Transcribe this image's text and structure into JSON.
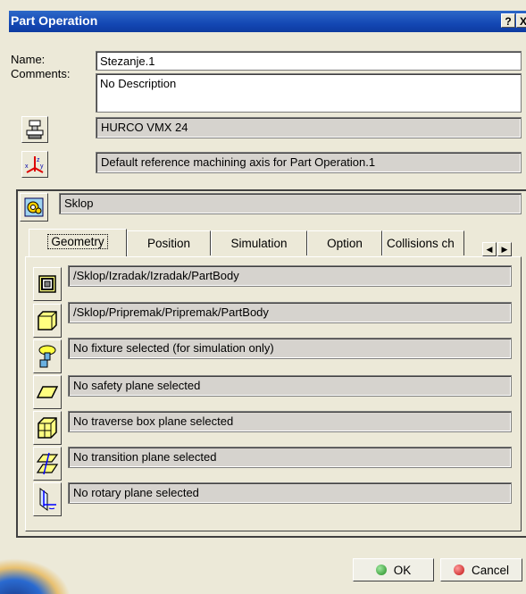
{
  "window": {
    "title": "Part Operation",
    "help_label": "?",
    "close_label": "X"
  },
  "name": {
    "label": "Name:",
    "value": "Stezanje.1"
  },
  "comments": {
    "label": "Comments:",
    "value": "No Description"
  },
  "machine": {
    "value": "HURCO VMX 24",
    "icon": "machine-icon"
  },
  "axis": {
    "value": "Default reference machining axis for Part Operation.1",
    "icon": "axis-system-icon"
  },
  "product": {
    "value": "Sklop",
    "icon": "product-icon"
  },
  "tabs": [
    {
      "label": "Geometry",
      "active": true
    },
    {
      "label": "Position"
    },
    {
      "label": "Simulation"
    },
    {
      "label": "Option"
    },
    {
      "label": "Collisions ch"
    }
  ],
  "tab_scroll": {
    "left": "◀",
    "right": "▶"
  },
  "geometry_rows": [
    {
      "icon": "design-part-icon",
      "value": "/Sklop/Izradak/Izradak/PartBody"
    },
    {
      "icon": "stock-icon",
      "value": "/Sklop/Pripremak/Pripremak/PartBody"
    },
    {
      "icon": "fixture-icon",
      "value": "No fixture selected (for simulation only)"
    },
    {
      "icon": "safety-plane-icon",
      "value": "No safety plane selected"
    },
    {
      "icon": "traverse-box-icon",
      "value": "No traverse box plane selected"
    },
    {
      "icon": "transition-plane-icon",
      "value": "No transition plane selected"
    },
    {
      "icon": "rotary-plane-icon",
      "value": "No rotary plane selected"
    }
  ],
  "buttons": {
    "ok": "OK",
    "cancel": "Cancel"
  },
  "colors": {
    "titlebar": "#1448b4",
    "ok_dot": "#2e9e2e",
    "cancel_dot": "#d02020",
    "yellow_icon": "#ffff80"
  }
}
